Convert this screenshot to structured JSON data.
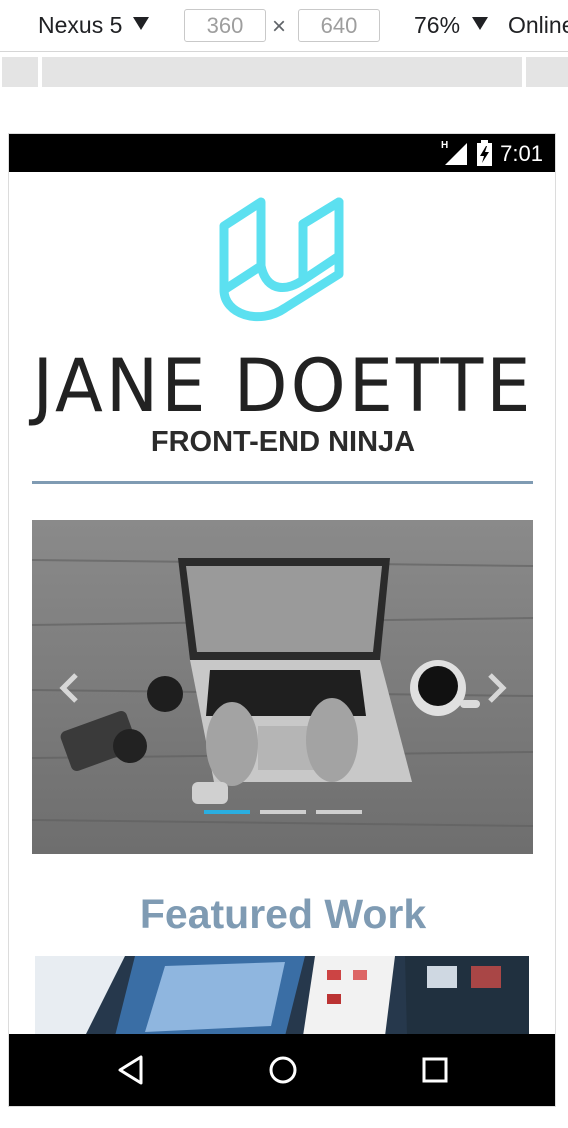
{
  "devtools": {
    "device": "Nexus 5",
    "width": "360",
    "height": "640",
    "times": "×",
    "zoom": "76%",
    "network": "Online"
  },
  "statusbar": {
    "time": "7:01",
    "network_type": "H"
  },
  "page": {
    "name": "JANE DOETTE",
    "subtitle": "FRONT-END NINJA",
    "featured_heading": "Featured Work"
  },
  "colors": {
    "logo": "#5ce0f0",
    "accent": "#7f9bb3",
    "indicator_active": "#2aaee0"
  },
  "carousel": {
    "slide_count": 3,
    "active_index": 0
  },
  "icons": [
    "chevron-down-icon",
    "signal-icon",
    "battery-icon",
    "back-icon",
    "home-icon",
    "recents-icon",
    "chevron-left-icon",
    "chevron-right-icon",
    "udacity-logo"
  ]
}
